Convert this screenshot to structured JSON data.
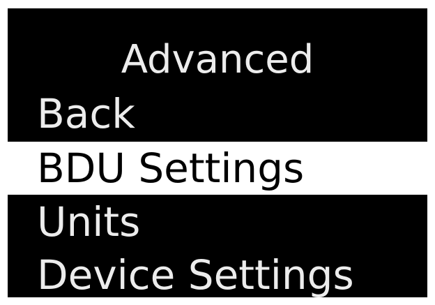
{
  "screen": {
    "title": "Advanced",
    "background": "#000000",
    "text_color": "#ececec",
    "selected_background": "#ffffff",
    "selected_text_color": "#000000"
  },
  "menu": {
    "items": [
      {
        "label": "Back",
        "selected": false
      },
      {
        "label": "BDU Settings",
        "selected": true
      },
      {
        "label": "Units",
        "selected": false
      },
      {
        "label": "Device Settings",
        "selected": false
      }
    ]
  }
}
